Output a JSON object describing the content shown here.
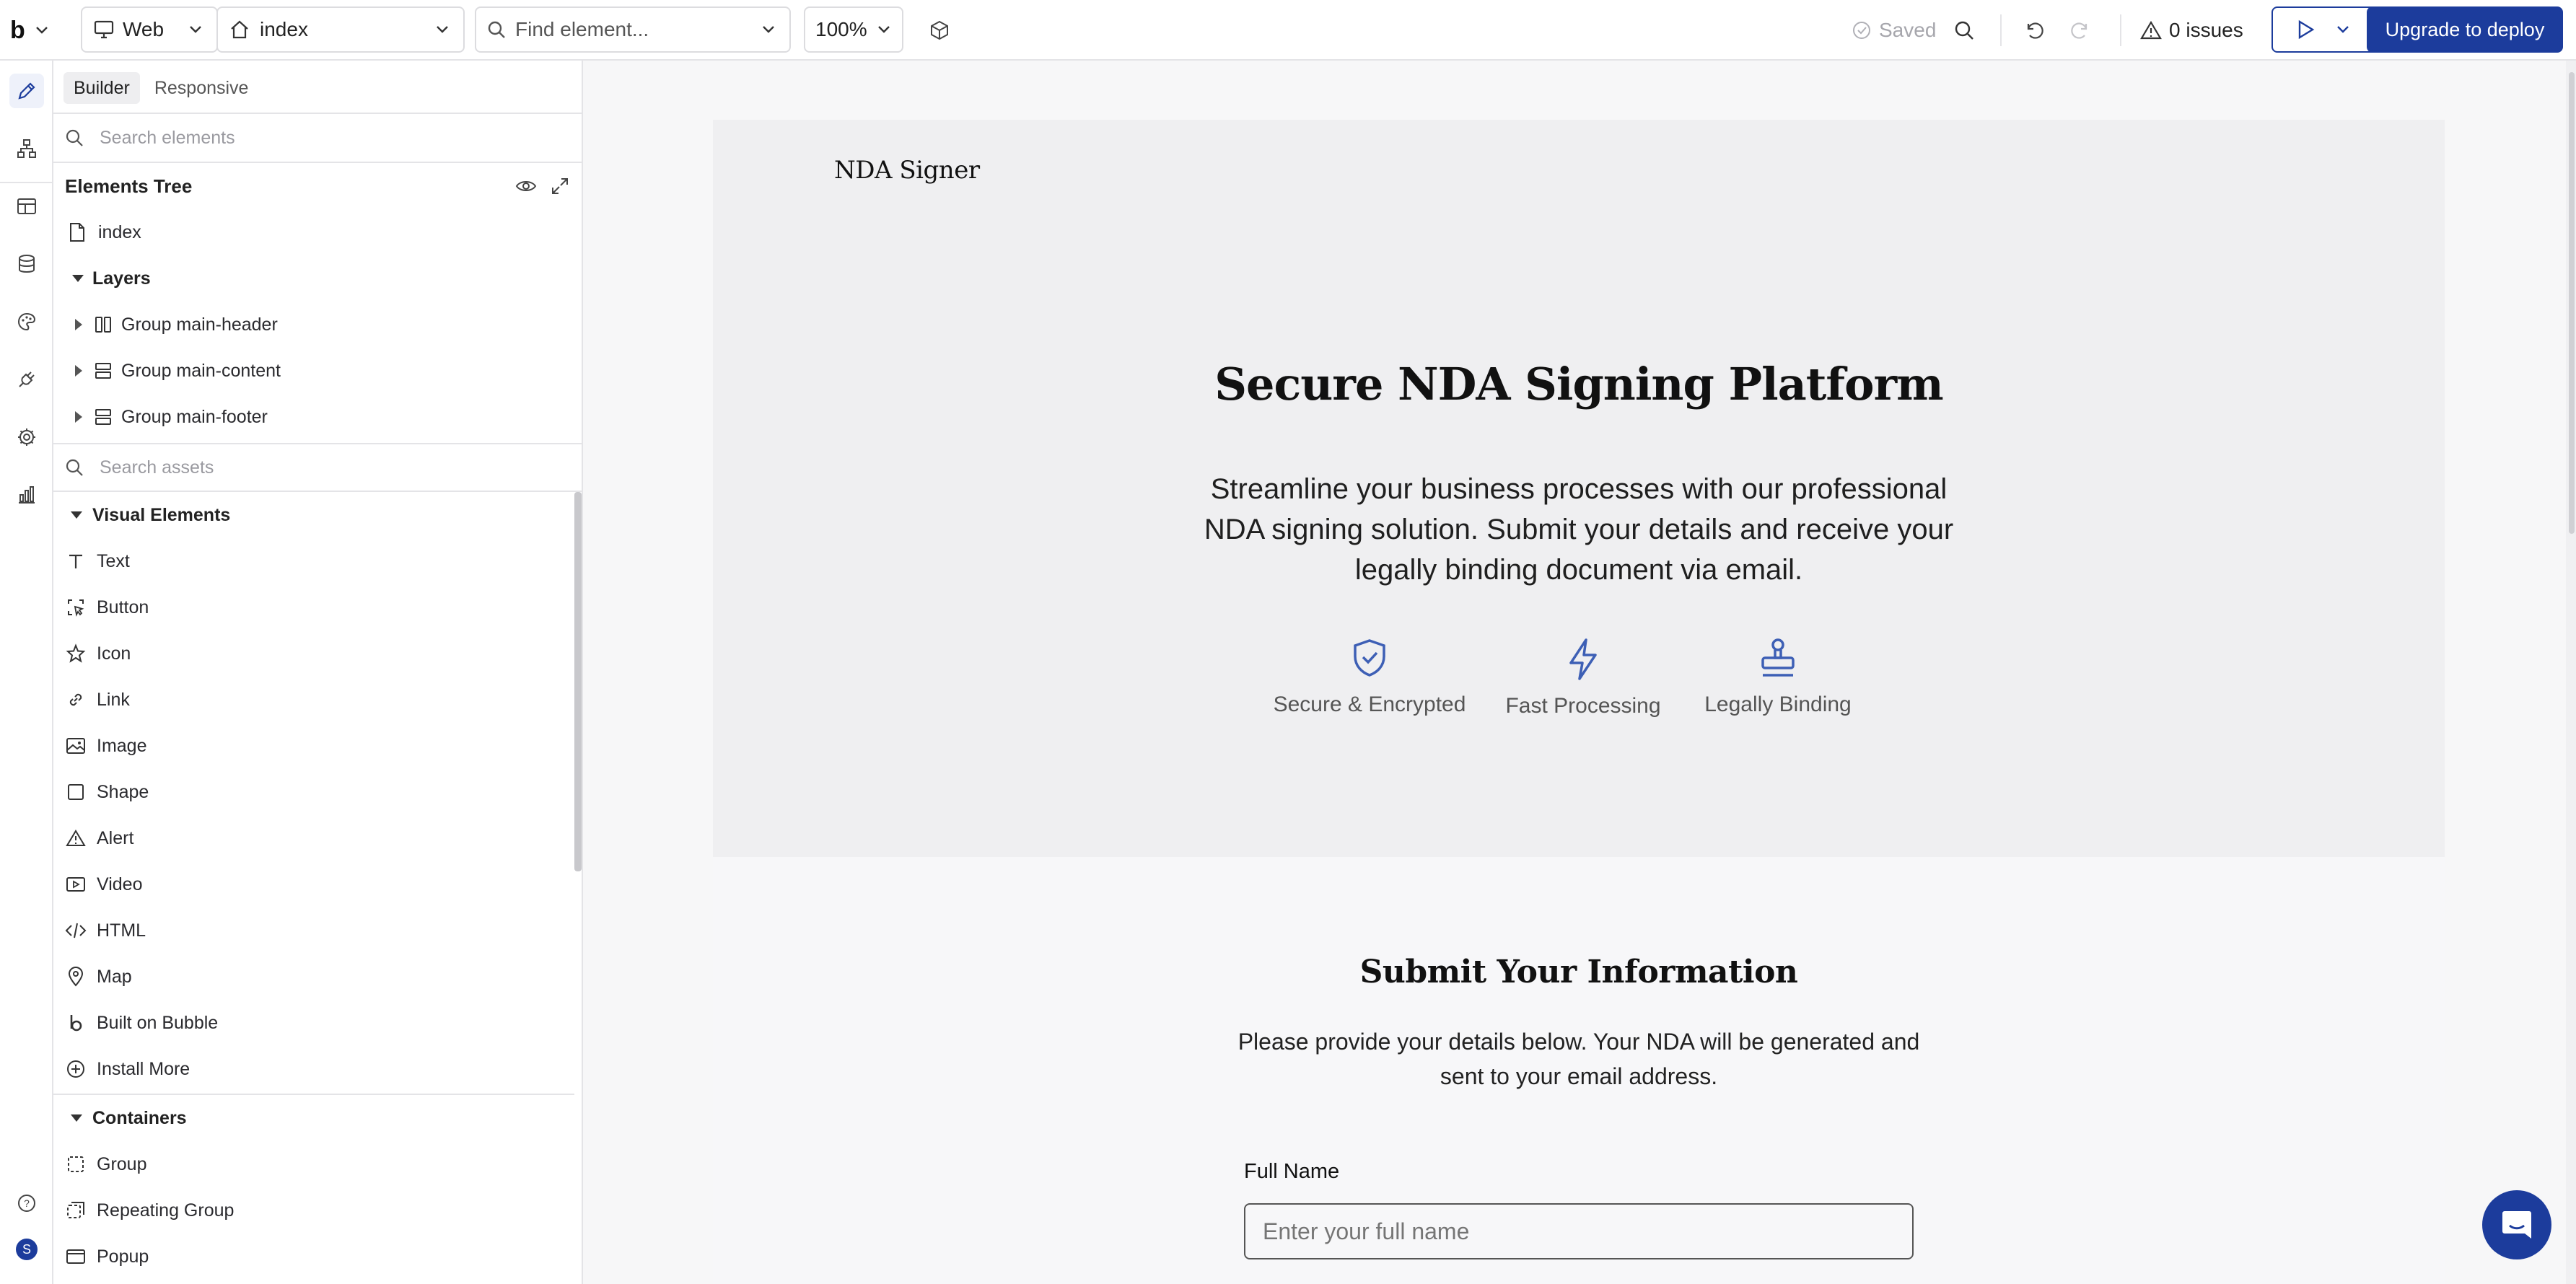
{
  "topbar": {
    "logo": "b",
    "platform": "Web",
    "page": "index",
    "find_placeholder": "Find element...",
    "zoom": "100%",
    "saved": "Saved",
    "issues": "0 issues",
    "upgrade": "Upgrade to deploy"
  },
  "rail": {
    "icons": [
      "design-pencil-icon",
      "workflow-icon",
      "styles-icon",
      "data-icon",
      "palette-icon",
      "plugins-icon",
      "settings-icon",
      "logs-icon"
    ],
    "help": "?",
    "avatar": "S"
  },
  "panel": {
    "tabs": [
      "Builder",
      "Responsive"
    ],
    "search_elements_placeholder": "Search elements",
    "tree_title": "Elements Tree",
    "page_item": "index",
    "layers_label": "Layers",
    "groups": [
      "Group main-header",
      "Group main-content",
      "Group main-footer"
    ],
    "search_assets_placeholder": "Search assets",
    "visual_label": "Visual Elements",
    "visual_items": [
      "Text",
      "Button",
      "Icon",
      "Link",
      "Image",
      "Shape",
      "Alert",
      "Video",
      "HTML",
      "Map",
      "Built on Bubble",
      "Install More"
    ],
    "containers_label": "Containers",
    "container_items": [
      "Group",
      "Repeating Group",
      "Popup"
    ]
  },
  "page": {
    "brand": "NDA Signer",
    "hero_title": "Secure NDA Signing Platform",
    "hero_lines": [
      "Streamline your business processes with our professional",
      "NDA signing solution. Submit your details and receive your",
      "legally binding document via email."
    ],
    "features": [
      "Secure & Encrypted",
      "Fast Processing",
      "Legally Binding"
    ],
    "form_title": "Submit Your Information",
    "form_lines": [
      "Please provide your details below. Your NDA will be generated and",
      "sent to your email address."
    ],
    "field_label": "Full Name",
    "field_placeholder": "Enter your full name"
  },
  "colors": {
    "primary": "#1c3c9c",
    "accent_icon": "#3d5fb5",
    "border": "#e4e4e7"
  }
}
